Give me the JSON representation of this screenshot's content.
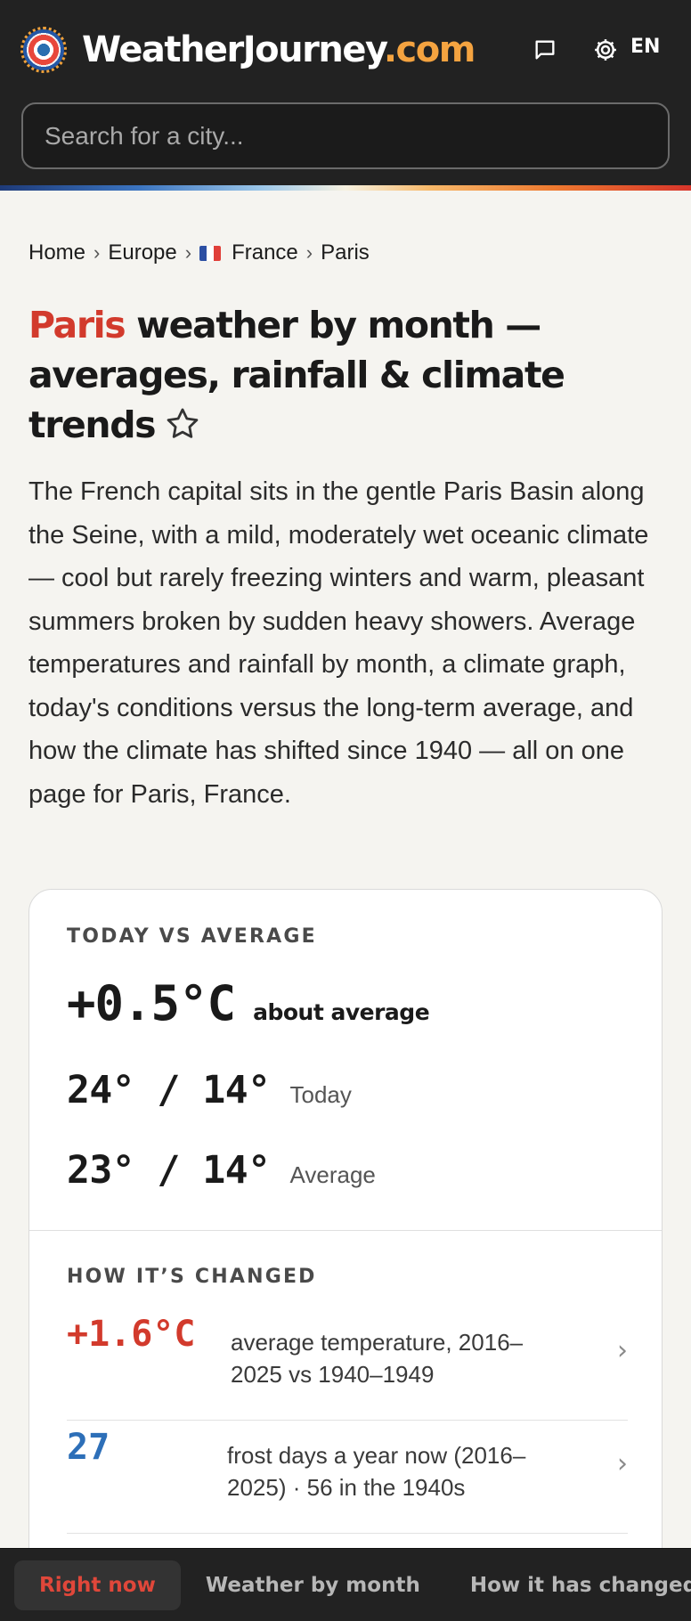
{
  "header": {
    "brand_name": "WeatherJourney",
    "brand_tld": ".com",
    "language": "EN",
    "icons": [
      "logo-icon",
      "chat-icon",
      "gear-icon"
    ],
    "colors": {
      "background": "#222222",
      "tld": "#f4a340"
    }
  },
  "search": {
    "placeholder": "Search for a city..."
  },
  "breadcrumb": [
    "Home",
    "Europe",
    "France",
    "Paris"
  ],
  "title": {
    "city": "Paris",
    "rest": " weather by month — averages, rainfall & climate trends",
    "favorite_icon": "star-icon"
  },
  "intro": "The French capital sits in the gentle Paris Basin along the Seine, with a mild, moderately wet oceanic climate — cool but rarely freezing winters and warm, pleasant summers broken by sudden heavy showers. Average temperatures and rainfall by month, a climate graph, today's conditions versus the long-term average, and how the climate has shifted since 1940 — all on one page for Paris, France.",
  "today_vs_average": {
    "label": "Today vs average",
    "delta": "+0.5°C",
    "delta_text": "about average",
    "today_temps": "24° / 14°",
    "today_label": "Today",
    "average_temps": "23° / 14°",
    "average_label": "Average"
  },
  "how_changed": {
    "label": "How it’s changed",
    "items": [
      {
        "value": "+1.6°C",
        "text": "average temperature, 2016–2025 vs 1940–1949",
        "color": "#d23a2c"
      },
      {
        "value": "27",
        "text": "frost days a year now (2016–2025) · 56 in the 1940s",
        "color": "#2d6fb8"
      }
    ]
  },
  "bottom_nav": {
    "items": [
      "Right now",
      "Weather by month",
      "How it has changed"
    ],
    "active": "Right now",
    "active_color": "#e0473a"
  }
}
